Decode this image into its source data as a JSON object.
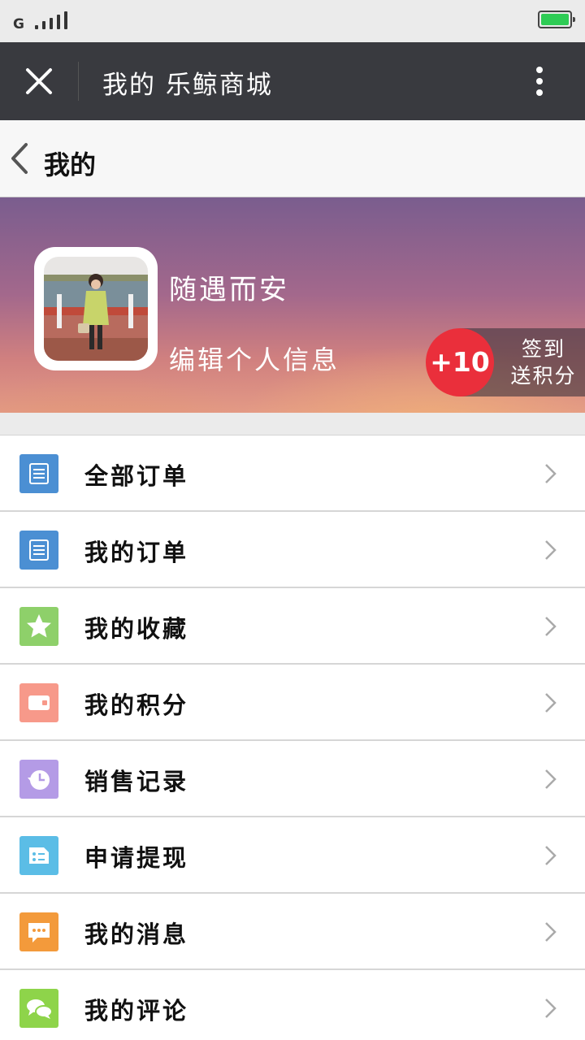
{
  "status_bar": {
    "network": "G"
  },
  "wechat_bar": {
    "title": "我的 乐鲸商城"
  },
  "header": {
    "title": "我的"
  },
  "profile": {
    "username": "随遇而安",
    "edit_label": "编辑个人信息",
    "checkin": {
      "points": "+10",
      "line1": "签到",
      "line2": "送积分"
    }
  },
  "colors": {
    "wechat_bar": "#393a3f",
    "checkin_badge": "#ea2f3b",
    "order_icon": "#4b8fd3",
    "favorite_icon": "#8ed06a",
    "points_icon": "#f7998a",
    "sales_icon": "#b49be6",
    "withdraw_icon": "#5bbde6",
    "message_icon": "#f39a3b",
    "comment_icon": "#8ed44a"
  },
  "menu": [
    {
      "label": "全部订单",
      "icon": "order-list-icon"
    },
    {
      "label": "我的订单",
      "icon": "my-orders-icon"
    },
    {
      "label": "我的收藏",
      "icon": "star-icon"
    },
    {
      "label": "我的积分",
      "icon": "wallet-icon"
    },
    {
      "label": "销售记录",
      "icon": "history-icon"
    },
    {
      "label": "申请提现",
      "icon": "withdraw-list-icon"
    },
    {
      "label": "我的消息",
      "icon": "message-icon"
    },
    {
      "label": "我的评论",
      "icon": "comment-icon"
    }
  ]
}
